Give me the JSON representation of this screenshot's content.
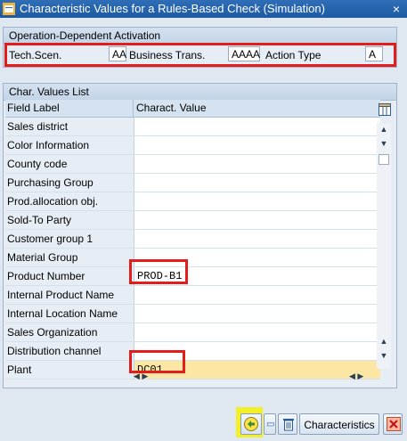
{
  "window": {
    "title": "Characteristic Values for a Rules-Based Check (Simulation)",
    "close_glyph": "×"
  },
  "activation": {
    "title": "Operation-Dependent Activation",
    "tech_scen_label": "Tech.Scen.",
    "tech_scen_value": "AA",
    "business_trans_label": "Business Trans.",
    "business_trans_value": "AAAA",
    "action_type_label": "Action Type",
    "action_type_value": "A"
  },
  "char_values": {
    "title": "Char. Values List",
    "columns": [
      "Field Label",
      "Charact. Value"
    ],
    "rows": [
      {
        "label": "Sales district",
        "value": ""
      },
      {
        "label": "Color Information",
        "value": ""
      },
      {
        "label": "County code",
        "value": ""
      },
      {
        "label": "Purchasing Group",
        "value": ""
      },
      {
        "label": "Prod.allocation obj.",
        "value": ""
      },
      {
        "label": "Sold-To Party",
        "value": ""
      },
      {
        "label": "Customer group 1",
        "value": ""
      },
      {
        "label": "Material Group",
        "value": ""
      },
      {
        "label": "Product Number",
        "value": "PROD-B1"
      },
      {
        "label": "Internal Product Name",
        "value": ""
      },
      {
        "label": "Internal Location Name",
        "value": ""
      },
      {
        "label": "Sales Organization",
        "value": ""
      },
      {
        "label": "Distribution channel",
        "value": ""
      },
      {
        "label": "Plant",
        "value": "DC01"
      }
    ]
  },
  "footer": {
    "characteristics_label": "Characteristics"
  },
  "icons": {
    "execute": "execute-icon",
    "delete": "delete-icon",
    "cancel": "cancel-icon",
    "table_settings": "table-settings-icon"
  },
  "colors": {
    "title_bar": "#1d5aa3",
    "highlight_red": "#e31c1c",
    "highlight_yellow": "#f3ef2b",
    "selected_row": "#fbe7a3"
  }
}
